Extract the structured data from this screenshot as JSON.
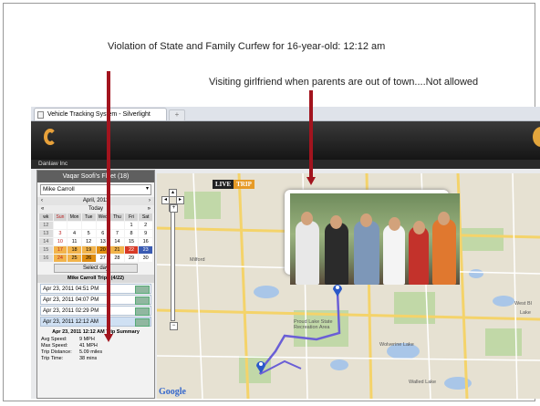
{
  "annotations": {
    "curfew": "Violation of State and Family Curfew for 16-year-old:  12:12 am",
    "girlfriend": "Visiting girlfriend when parents are out of town....Not allowed"
  },
  "browser": {
    "tab_title": "Vehicle Tracking System - Silverlight",
    "new_tab": "+"
  },
  "app": {
    "company": "Danlaw Inc"
  },
  "sidebar": {
    "fleet_title": "Vaqar Soofi's Fleet (18)",
    "vehicle": "Mike Carroll",
    "calendar": {
      "month": "April, 2011",
      "prev_year": "«",
      "next_year": "»",
      "prev": "‹",
      "next": "›",
      "today": "Today",
      "headers": [
        "wk",
        "Sun",
        "Mon",
        "Tue",
        "Wed",
        "Thu",
        "Fri",
        "Sat"
      ],
      "rows": [
        [
          "12",
          "",
          "",
          "",
          "",
          "",
          "1",
          "2"
        ],
        [
          "13",
          "3",
          "4",
          "5",
          "6",
          "7",
          "8",
          "9"
        ],
        [
          "14",
          "10",
          "11",
          "12",
          "13",
          "14",
          "15",
          "16"
        ],
        [
          "15",
          "17",
          "18",
          "19",
          "20",
          "21",
          "22",
          "23"
        ],
        [
          "16",
          "24",
          "25",
          "26",
          "27",
          "28",
          "29",
          "30"
        ]
      ]
    },
    "select_day": "Select day",
    "trips_header": "Mike Carroll Trips (4/22)",
    "trips": [
      "Apr 23, 2011 04:51 PM",
      "Apr 23, 2011 04:07 PM",
      "Apr 23, 2011 02:29 PM",
      "Apr 23, 2011 12:12 AM"
    ],
    "summary": {
      "title": "Apr 23, 2011 12:12 AM Trip Summary",
      "rows": [
        {
          "label": "Avg Speed:",
          "value": "9 MPH"
        },
        {
          "label": "Max Speed:",
          "value": "41 MPH"
        },
        {
          "label": "Trip Distance:",
          "value": "5.09 miles"
        },
        {
          "label": "Trip Time:",
          "value": "38 mins"
        }
      ]
    }
  },
  "map": {
    "live_label": "LIVE",
    "trip_label": "TRIP",
    "google": "Google",
    "labels": {
      "milford": "Milford",
      "proud_lake": "Proud Lake State Recreation Area",
      "wolverine": "Wolverine Lake",
      "walled_lake": "Walled Lake",
      "west_bl": "West Bl",
      "lake": "Lake"
    }
  },
  "colors": {
    "arrow": "#a2141e",
    "route": "#6a5ed6",
    "pin": "#2a59c9",
    "accent": "#e69a27"
  }
}
